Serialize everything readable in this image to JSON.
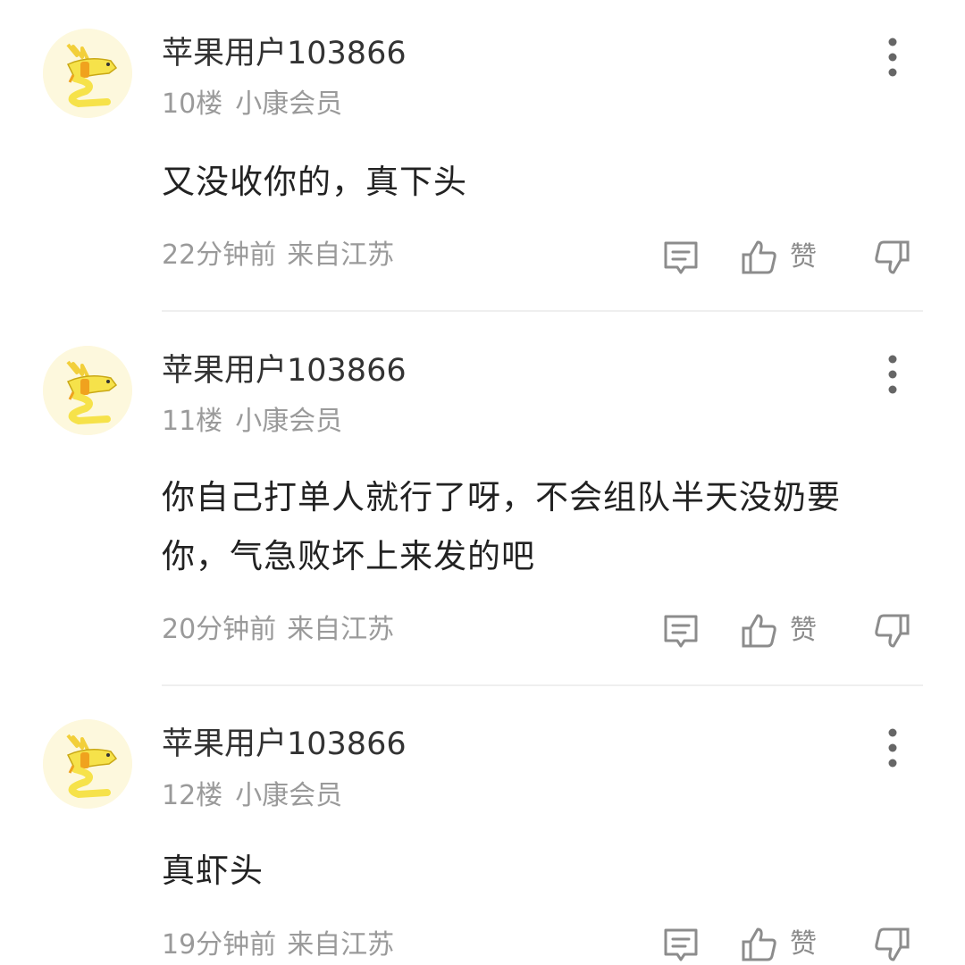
{
  "comments": [
    {
      "username": "苹果用户103866",
      "floor": "10楼",
      "badge": "小康会员",
      "text": "又没收你的，真下头",
      "time": "22分钟前",
      "location": "来自江苏",
      "like_label": "赞"
    },
    {
      "username": "苹果用户103866",
      "floor": "11楼",
      "badge": "小康会员",
      "text": "你自己打单人就行了呀，不会组队半天没奶要你，气急败坏上来发的吧",
      "time": "20分钟前",
      "location": "来自江苏",
      "like_label": "赞"
    },
    {
      "username": "苹果用户103866",
      "floor": "12楼",
      "badge": "小康会员",
      "text": "真虾头",
      "time": "19分钟前",
      "location": "来自江苏",
      "like_label": "赞"
    }
  ],
  "icons": {
    "avatar": "bird-avatar-icon",
    "more": "more-vertical-icon",
    "reply": "reply-icon",
    "like": "thumbs-up-icon",
    "dislike": "thumbs-down-icon"
  },
  "colors": {
    "text_primary": "#222222",
    "text_secondary": "#9a9a9a",
    "icon_gray": "#8c8c8c",
    "avatar_bg": "#fdf8dd",
    "avatar_yellow": "#f6e24a",
    "avatar_orange": "#f0a21e",
    "divider": "#efefef"
  }
}
